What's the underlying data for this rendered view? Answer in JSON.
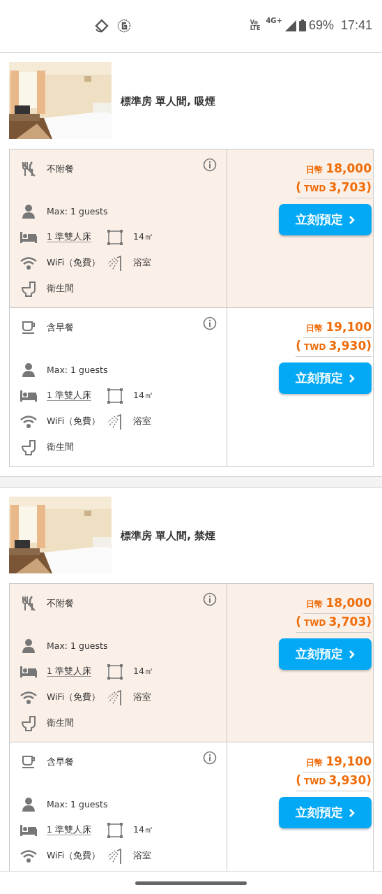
{
  "status_bar": {
    "volte": [
      "Vo",
      "LTE"
    ],
    "network": "4G+",
    "battery": "69%",
    "time": "17:41"
  },
  "rooms": [
    {
      "kind": "picture",
      "name": "標準房 單人間, 吸煙",
      "rates": [
        {
          "highlighted": true,
          "meal": {
            "kind": "no_meal",
            "label": "不附餐"
          },
          "price": {
            "currency": "日幣",
            "amount": "18,000",
            "open": "(",
            "converted_currency": "TWD",
            "converted_amount": "3,703",
            "close": ")"
          },
          "button": "立刻預定",
          "features": [
            [
              {
                "kind": "person",
                "text": "Max: 1 guests",
                "link": false
              }
            ],
            [
              {
                "kind": "bed",
                "text": "1 準雙人床",
                "link": true
              },
              {
                "kind": "area",
                "text": "14㎡",
                "link": false
              }
            ],
            [
              {
                "kind": "wifi",
                "text": "WiFi（免費）",
                "link": false
              },
              {
                "kind": "shower",
                "text": "浴室",
                "link": false
              }
            ],
            [
              {
                "kind": "toilet",
                "text": "衛生間",
                "link": false
              }
            ]
          ]
        },
        {
          "highlighted": false,
          "meal": {
            "kind": "cup",
            "label": "含早餐"
          },
          "price": {
            "currency": "日幣",
            "amount": "19,100",
            "open": "(",
            "converted_currency": "TWD",
            "converted_amount": "3,930",
            "close": ")"
          },
          "button": "立刻預定",
          "features": [
            [
              {
                "kind": "person",
                "text": "Max: 1 guests",
                "link": false
              }
            ],
            [
              {
                "kind": "bed",
                "text": "1 準雙人床",
                "link": true
              },
              {
                "kind": "area",
                "text": "14㎡",
                "link": false
              }
            ],
            [
              {
                "kind": "wifi",
                "text": "WiFi（免費）",
                "link": false
              },
              {
                "kind": "shower",
                "text": "浴室",
                "link": false
              }
            ],
            [
              {
                "kind": "toilet",
                "text": "衛生間",
                "link": false
              }
            ]
          ]
        }
      ]
    },
    {
      "kind": "picture",
      "name": "標準房 單人間, 禁煙",
      "rates": [
        {
          "highlighted": true,
          "meal": {
            "kind": "no_meal",
            "label": "不附餐"
          },
          "price": {
            "currency": "日幣",
            "amount": "18,000",
            "open": "(",
            "converted_currency": "TWD",
            "converted_amount": "3,703",
            "close": ")"
          },
          "button": "立刻預定",
          "features": [
            [
              {
                "kind": "person",
                "text": "Max: 1 guests",
                "link": false
              }
            ],
            [
              {
                "kind": "bed",
                "text": "1 準雙人床",
                "link": true
              },
              {
                "kind": "area",
                "text": "14㎡",
                "link": false
              }
            ],
            [
              {
                "kind": "wifi",
                "text": "WiFi（免費）",
                "link": false
              },
              {
                "kind": "shower",
                "text": "浴室",
                "link": false
              }
            ],
            [
              {
                "kind": "toilet",
                "text": "衛生間",
                "link": false
              }
            ]
          ]
        },
        {
          "highlighted": false,
          "meal": {
            "kind": "cup",
            "label": "含早餐"
          },
          "price": {
            "currency": "日幣",
            "amount": "19,100",
            "open": "(",
            "converted_currency": "TWD",
            "converted_amount": "3,930",
            "close": ")"
          },
          "button": "立刻預定",
          "features": [
            [
              {
                "kind": "person",
                "text": "Max: 1 guests",
                "link": false
              }
            ],
            [
              {
                "kind": "bed",
                "text": "1 準雙人床",
                "link": true
              },
              {
                "kind": "area",
                "text": "14㎡",
                "link": false
              }
            ],
            [
              {
                "kind": "wifi",
                "text": "WiFi（免費）",
                "link": false
              },
              {
                "kind": "shower",
                "text": "浴室",
                "link": false
              }
            ]
          ]
        }
      ]
    }
  ]
}
